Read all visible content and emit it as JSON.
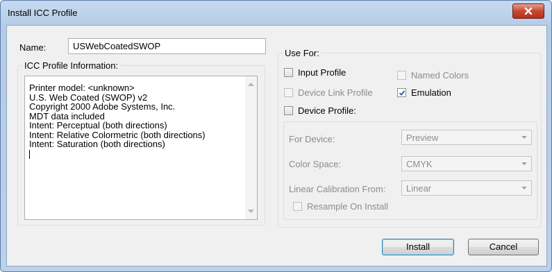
{
  "window": {
    "title": "Install ICC Profile"
  },
  "name_field": {
    "label": "Name:",
    "value": "USWebCoatedSWOP"
  },
  "profile_info": {
    "legend": "ICC Profile Information:",
    "lines": [
      "Printer model: <unknown>",
      "U.S. Web Coated (SWOP) v2",
      "Copyright 2000 Adobe Systems, Inc.",
      "MDT data included",
      "Intent: Perceptual (both directions)",
      "Intent: Relative Colormetric (both directions)",
      "Intent: Saturation (both directions)"
    ]
  },
  "use_for": {
    "legend": "Use For:",
    "input_profile": {
      "label": "Input Profile",
      "checked": false,
      "enabled": true
    },
    "named_colors": {
      "label": "Named Colors",
      "checked": false,
      "enabled": false
    },
    "device_link_profile": {
      "label": "Device Link Profile",
      "checked": false,
      "enabled": false
    },
    "emulation": {
      "label": "Emulation",
      "checked": true,
      "enabled": true
    },
    "device_profile": {
      "label": "Device Profile:",
      "checked": false,
      "enabled": true
    }
  },
  "device_settings": {
    "for_device": {
      "label": "For Device:",
      "value": "Preview"
    },
    "color_space": {
      "label": "Color Space:",
      "value": "CMYK"
    },
    "linear_calibration": {
      "label": "Linear Calibration From:",
      "value": "Linear"
    },
    "resample": {
      "label": "Resample On Install",
      "checked": false
    }
  },
  "buttons": {
    "install": "Install",
    "cancel": "Cancel"
  },
  "colors": {
    "title_bar": "#c6d9f0",
    "close_button": "#c8482f",
    "check_mark": "#2a5a9c",
    "dialog_bg": "#f0f0f0"
  },
  "icons": [
    "close-icon",
    "check-icon",
    "scroll-up-icon",
    "scroll-down-icon",
    "dropdown-arrow-icon"
  ]
}
